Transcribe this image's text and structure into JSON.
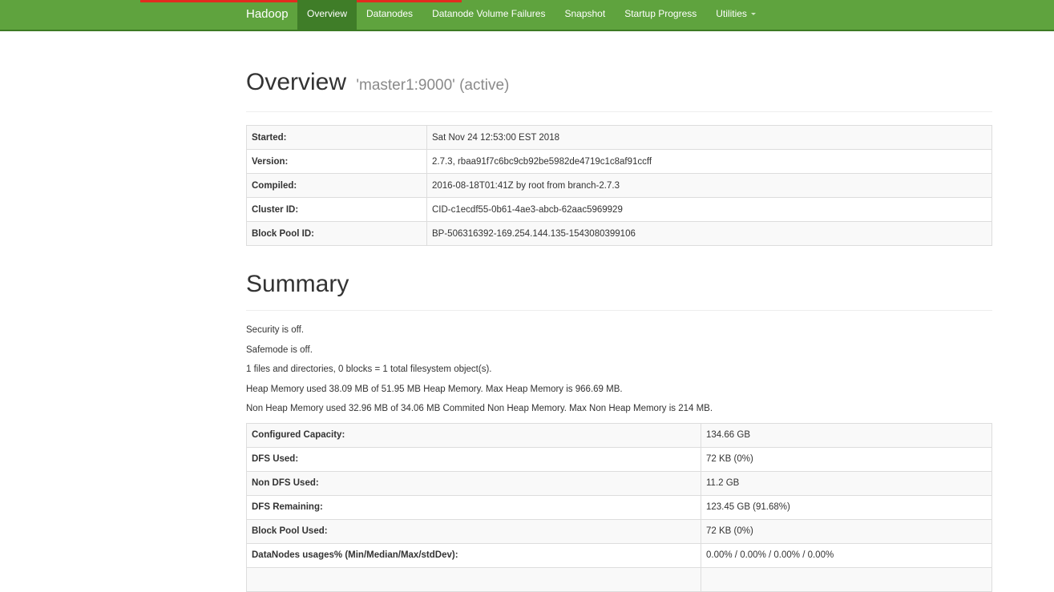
{
  "nav": {
    "brand": "Hadoop",
    "items": [
      {
        "label": "Overview",
        "active": true
      },
      {
        "label": "Datanodes"
      },
      {
        "label": "Datanode Volume Failures"
      },
      {
        "label": "Snapshot"
      },
      {
        "label": "Startup Progress"
      },
      {
        "label": "Utilities"
      }
    ]
  },
  "overview": {
    "title": "Overview",
    "subtitle": "'master1:9000' (active)",
    "rows": [
      {
        "label": "Started:",
        "value": "Sat Nov 24 12:53:00 EST 2018"
      },
      {
        "label": "Version:",
        "value": "2.7.3, rbaa91f7c6bc9cb92be5982de4719c1c8af91ccff"
      },
      {
        "label": "Compiled:",
        "value": "2016-08-18T01:41Z by root from branch-2.7.3"
      },
      {
        "label": "Cluster ID:",
        "value": "CID-c1ecdf55-0b61-4ae3-abcb-62aac5969929"
      },
      {
        "label": "Block Pool ID:",
        "value": "BP-506316392-169.254.144.135-1543080399106"
      }
    ]
  },
  "summary": {
    "title": "Summary",
    "lines": [
      "Security is off.",
      "Safemode is off.",
      "1 files and directories, 0 blocks = 1 total filesystem object(s).",
      "Heap Memory used 38.09 MB of 51.95 MB Heap Memory. Max Heap Memory is 966.69 MB.",
      "Non Heap Memory used 32.96 MB of 34.06 MB Commited Non Heap Memory. Max Non Heap Memory is 214 MB."
    ],
    "rows": [
      {
        "label": "Configured Capacity:",
        "value": "134.66 GB"
      },
      {
        "label": "DFS Used:",
        "value": "72 KB (0%)"
      },
      {
        "label": "Non DFS Used:",
        "value": "11.2 GB"
      },
      {
        "label": "DFS Remaining:",
        "value": "123.45 GB (91.68%)"
      },
      {
        "label": "Block Pool Used:",
        "value": "72 KB (0%)"
      },
      {
        "label": "DataNodes usages% (Min/Median/Max/stdDev):",
        "value": "0.00% / 0.00% / 0.00% / 0.00%"
      },
      {
        "label": "",
        "value": ""
      }
    ]
  }
}
